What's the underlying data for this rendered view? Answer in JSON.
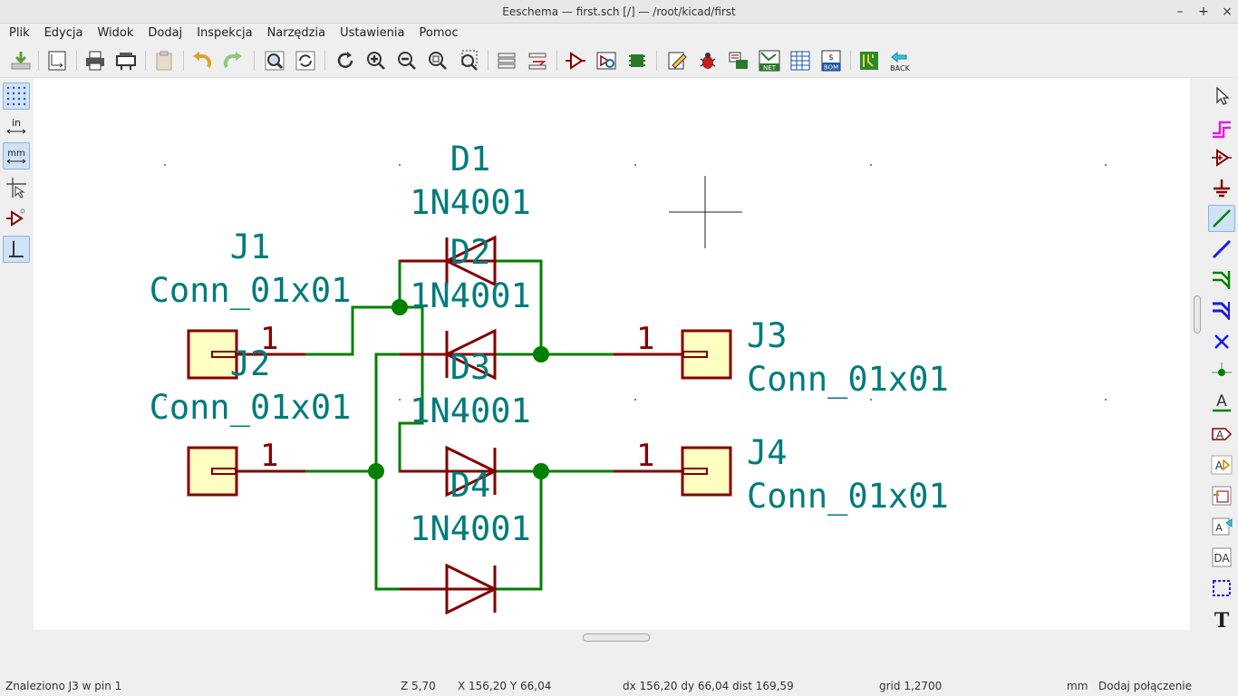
{
  "window": {
    "title": "Eeschema — first.sch [/] — /root/kicad/first",
    "minimize": "–",
    "maximize": "+",
    "close": "×"
  },
  "menu": [
    "Plik",
    "Edycja",
    "Widok",
    "Dodaj",
    "Inspekcja",
    "Narzędzia",
    "Ustawienia",
    "Pomoc"
  ],
  "toolbar": {
    "net_label": "NET",
    "bom_label": "BOM",
    "back_label": "BACK"
  },
  "left_toolbar": {
    "units_in": "in",
    "units_mm": "mm"
  },
  "right_toolbar": {
    "text_a": "A",
    "text_t": "T"
  },
  "schematic": {
    "components": [
      {
        "ref": "D1",
        "value": "1N4001"
      },
      {
        "ref": "D2",
        "value": "1N4001"
      },
      {
        "ref": "D3",
        "value": "1N4001"
      },
      {
        "ref": "D4",
        "value": "1N4001"
      },
      {
        "ref": "J1",
        "value": "Conn_01x01",
        "pin": "1"
      },
      {
        "ref": "J2",
        "value": "Conn_01x01",
        "pin": "1"
      },
      {
        "ref": "J3",
        "value": "Conn_01x01",
        "pin": "1"
      },
      {
        "ref": "J4",
        "value": "Conn_01x01",
        "pin": "1"
      }
    ],
    "colors": {
      "wire": "#008000",
      "component": "#840000",
      "field": "#007b7b",
      "junction": "#008000",
      "pin_fill": "#ffffc2"
    }
  },
  "status": {
    "message": "Znaleziono J3 w pin 1",
    "zoom": "Z 5,70",
    "xy": "X 156,20  Y 66,04",
    "delta": "dx 156,20  dy 66,04  dist 169,59",
    "grid": "grid 1,2700",
    "units": "mm",
    "mode": "Dodaj połączenie"
  }
}
